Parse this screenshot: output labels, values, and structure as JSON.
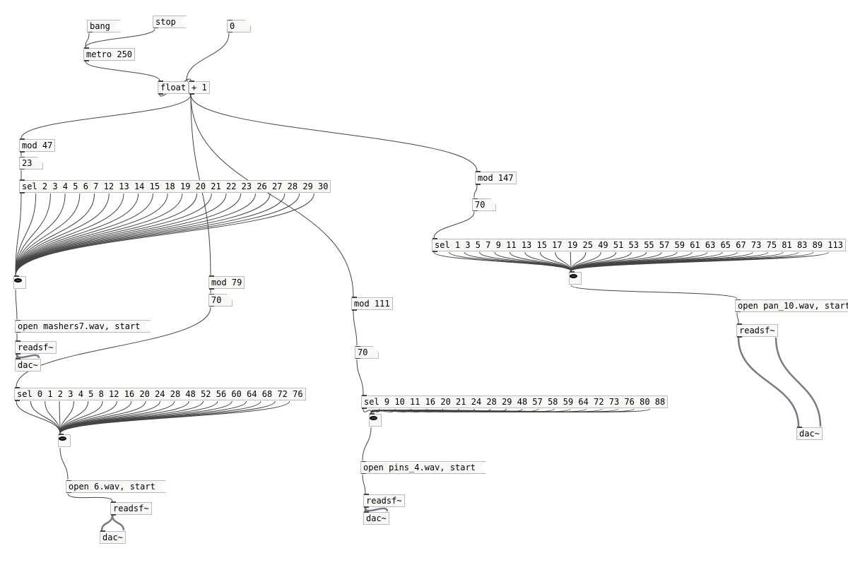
{
  "top": {
    "bang": "bang",
    "stop": "stop",
    "reset": "0",
    "metro": "metro 250",
    "float": "float",
    "plus1": "+ 1"
  },
  "A": {
    "mod": "mod 47",
    "num": "23",
    "sel": "sel 2 3 4 5 6 7 12 13 14 15 18 19 20 21 22 23 26 27 28 29 30",
    "sel_outlets": 22,
    "open": "open mashers7.wav, start",
    "readsf": "readsf~",
    "dac": "dac~"
  },
  "B": {
    "mod": "mod 79",
    "num": "70",
    "sel": "sel 0 1 2 3 4 5 8 12 16 20 24 28 48 52 56 60 64 68 72 76",
    "sel_outlets": 21,
    "open": "open 6.wav, start",
    "readsf": "readsf~",
    "dac": "dac~"
  },
  "C": {
    "mod": "mod 111",
    "num": "70",
    "sel": "sel 9 10 11 16 20 21 24 28 29 48 57 58 59 64 72 73 76 80 88",
    "sel_outlets": 20,
    "open": "open pins_4.wav, start",
    "readsf": "readsf~",
    "dac": "dac~"
  },
  "D": {
    "mod": "mod 147",
    "num": "70",
    "sel": "sel 1 3 5 7 9 11 13 15 17 19 25 49 51 53 55 57 59 61 63 65 67 73 75 81 83 89 113",
    "sel_outlets": 28,
    "open": "open pan_10.wav, start",
    "readsf": "readsf~",
    "dac": "dac~"
  }
}
